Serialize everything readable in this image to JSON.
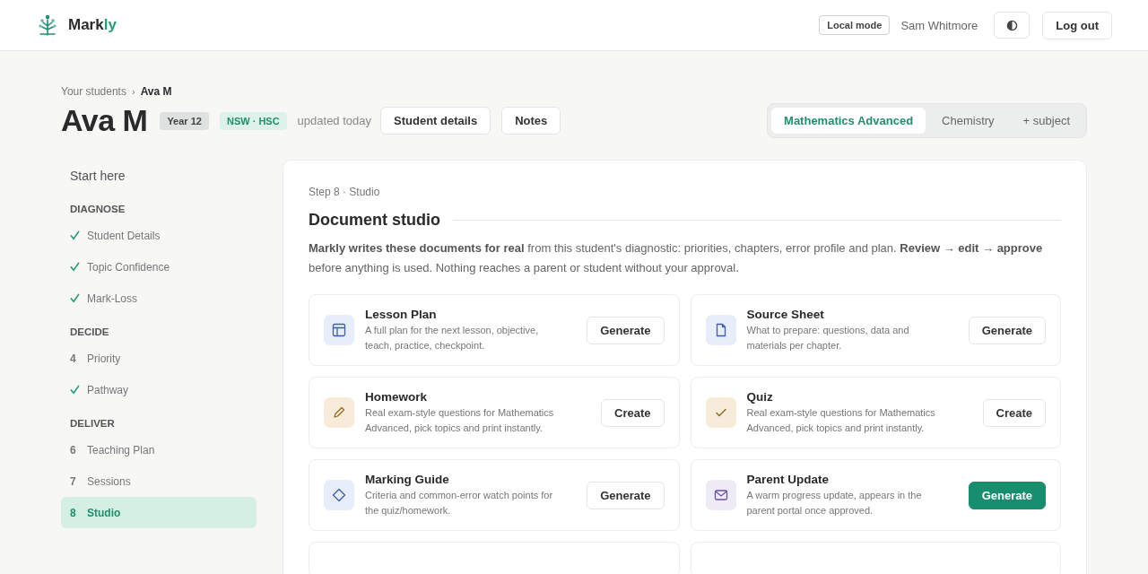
{
  "header": {
    "brand": {
      "name": "Mark",
      "accent": "ly"
    },
    "mode_badge": "Local mode",
    "user": "Sam Whitmore",
    "logout": "Log out"
  },
  "breadcrumb": [
    {
      "label": "Your students",
      "current": false
    },
    {
      "label": "Ava M",
      "current": true
    }
  ],
  "breadcrumb_separator": "›",
  "student": {
    "name": "Ava M",
    "tags": [
      {
        "label": "Year 12",
        "kind": "grey"
      },
      {
        "label": "NSW · HSC",
        "kind": "green"
      }
    ],
    "updated": "updated today",
    "buttons": [
      "Student details",
      "Notes"
    ]
  },
  "subject_tabs": [
    {
      "label": "Mathematics Advanced",
      "selected": true
    },
    {
      "label": "Chemistry",
      "selected": false
    },
    {
      "label": "+ subject",
      "selected": false
    }
  ],
  "sidebar": {
    "items": [
      {
        "kind": "link",
        "label": "Start here",
        "selected": false
      },
      {
        "kind": "section",
        "label": "DIAGNOSE"
      },
      {
        "kind": "step",
        "label": "Student Details",
        "done": true,
        "selected": false
      },
      {
        "kind": "step",
        "label": "Topic Confidence",
        "done": true,
        "selected": false
      },
      {
        "kind": "step",
        "label": "Mark-Loss",
        "done": true,
        "selected": false
      },
      {
        "kind": "section",
        "label": "DECIDE"
      },
      {
        "kind": "step",
        "number": "4",
        "label": "Priority",
        "done": false,
        "selected": false
      },
      {
        "kind": "step",
        "label": "Pathway",
        "done": true,
        "selected": false
      },
      {
        "kind": "section",
        "label": "DELIVER"
      },
      {
        "kind": "step",
        "number": "6",
        "label": "Teaching Plan",
        "done": false,
        "selected": false
      },
      {
        "kind": "step",
        "number": "7",
        "label": "Sessions",
        "done": false,
        "selected": false
      },
      {
        "kind": "step",
        "number": "8",
        "label": "Studio",
        "done": false,
        "selected": true
      }
    ]
  },
  "studio": {
    "step": "Step 8 · Studio",
    "title": "Document studio",
    "intro": "**Markly writes these documents for real** from this student's diagnostic: priorities, chapters, error profile and plan. **Review → edit → approve** before anything is used. Nothing reaches a parent or student without your approval.",
    "documents": [
      {
        "title": "Lesson Plan",
        "description": "A full plan for the next lesson, objective, teach, practice, checkpoint.",
        "kind": "layout",
        "color": "#e7eef9",
        "action": "Generate",
        "primary": false
      },
      {
        "title": "Source Sheet",
        "description": "What to prepare: questions, data and materials per chapter.",
        "kind": "file",
        "color": "#e7eef9",
        "action": "Generate",
        "primary": false
      },
      {
        "title": "Homework",
        "description": "Real exam-style questions for Mathematics Advanced, pick topics and print instantly.",
        "kind": "pencil",
        "color": "#f6ecd9",
        "action": "Create",
        "primary": false
      },
      {
        "title": "Quiz",
        "description": "Real exam-style questions for Mathematics Advanced, pick topics and print instantly.",
        "kind": "check",
        "color": "#f6ecd9",
        "action": "Create",
        "primary": false
      },
      {
        "title": "Marking Guide",
        "description": "Criteria and common-error watch points for the quiz/homework.",
        "kind": "diamond",
        "color": "#e7eef9",
        "action": "Generate",
        "primary": false
      },
      {
        "title": "Parent Update",
        "description": "A warm progress update, appears in the parent portal once approved.",
        "kind": "mail",
        "color": "#eeeaf6",
        "action": "Generate",
        "primary": true
      }
    ]
  }
}
